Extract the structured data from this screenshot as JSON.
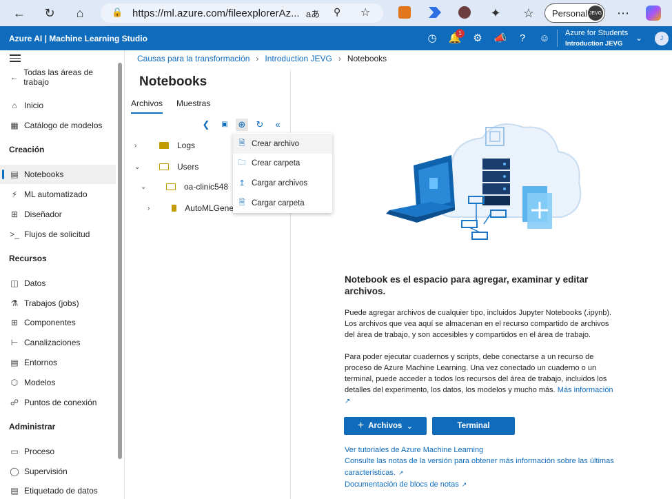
{
  "browser": {
    "url": "https://ml.azure.com/fileexplorerAz...",
    "profile_label": "Personal",
    "profile_avatar_text": "JEVG"
  },
  "header": {
    "title": "Azure AI | Machine Learning Studio",
    "notifications_count": "1",
    "account_line1": "Azure for Students",
    "account_line2": "Introduction JEVG",
    "account_initial": "J"
  },
  "leftnav": {
    "back_label": "Todas las áreas de trabajo",
    "items_top": [
      {
        "label": "Inicio",
        "icon": "home-icon"
      },
      {
        "label": "Catálogo de modelos",
        "icon": "catalog-icon"
      }
    ],
    "section_creacion": "Creación",
    "items_creacion": [
      {
        "label": "Notebooks",
        "icon": "notebook-icon"
      },
      {
        "label": "ML automatizado",
        "icon": "automl-icon"
      },
      {
        "label": "Diseñador",
        "icon": "designer-icon"
      },
      {
        "label": "Flujos de solicitud",
        "icon": "prompt-flow-icon"
      }
    ],
    "section_recursos": "Recursos",
    "items_recursos": [
      {
        "label": "Datos",
        "icon": "data-icon"
      },
      {
        "label": "Trabajos (jobs)",
        "icon": "jobs-icon"
      },
      {
        "label": "Componentes",
        "icon": "components-icon"
      },
      {
        "label": "Canalizaciones",
        "icon": "pipelines-icon"
      },
      {
        "label": "Entornos",
        "icon": "environments-icon"
      },
      {
        "label": "Modelos",
        "icon": "models-icon"
      },
      {
        "label": "Puntos de conexión",
        "icon": "endpoints-icon"
      }
    ],
    "section_administrar": "Administrar",
    "items_administrar": [
      {
        "label": "Proceso",
        "icon": "compute-icon"
      },
      {
        "label": "Supervisión",
        "icon": "monitoring-icon"
      },
      {
        "label": "Etiquetado de datos",
        "icon": "labeling-icon"
      }
    ]
  },
  "breadcrumb": {
    "items": [
      "Causas para la transformación",
      "Introduction JEVG",
      "Notebooks"
    ]
  },
  "filepanel": {
    "title": "Notebooks",
    "tabs": [
      "Archivos",
      "Muestras"
    ],
    "tree": [
      {
        "label": "Logs"
      },
      {
        "label": "Users"
      },
      {
        "label": "oa-clinic548"
      },
      {
        "label": "AutoMLGene"
      }
    ]
  },
  "menu": {
    "items": [
      "Crear archivo",
      "Crear carpeta",
      "Cargar archivos",
      "Cargar carpeta"
    ]
  },
  "main": {
    "heading": "Notebook es el espacio para agregar, examinar y editar archivos.",
    "para1": "Puede agregar archivos de cualquier tipo, incluidos Jupyter Notebooks (.ipynb). Los archivos que vea aquí se almacenan en el recurso compartido de archivos del área de trabajo, y son accesibles y compartidos en el área de trabajo.",
    "para2": "Para poder ejecutar cuadernos y scripts, debe conectarse a un recurso de proceso de Azure Machine Learning. Una vez conectado un cuaderno o un terminal, puede acceder a todos los recursos del área de trabajo, incluidos los detalles del experimento, los datos, los modelos y mucho más.",
    "more_info": "Más información",
    "btn_files": "Archivos",
    "btn_terminal": "Terminal",
    "link1": "Ver tutoriales de Azure Machine Learning",
    "link2a": "Consulte las notas de la versión para obtener más información sobre las últimas",
    "link2b": "características.",
    "link3": "Documentación de blocs de notas"
  },
  "colors": {
    "brand": "#0f6cbd",
    "folder": "#c19c00"
  }
}
